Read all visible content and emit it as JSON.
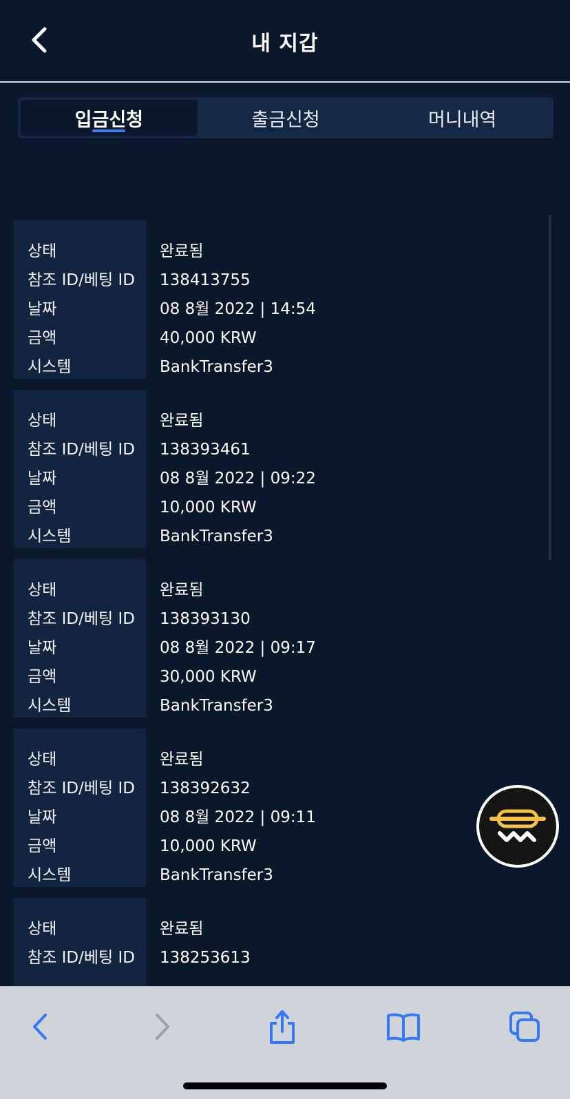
{
  "header": {
    "title": "내 지갑"
  },
  "tabs": [
    {
      "label": "입금신청",
      "active": true
    },
    {
      "label": "출금신청",
      "active": false
    },
    {
      "label": "머니내역",
      "active": false
    }
  ],
  "field_labels": {
    "status": "상태",
    "ref_id": "참조 ID/베팅 ID",
    "date": "날짜",
    "amount": "금액",
    "system": "시스템"
  },
  "transactions": [
    {
      "status": "완료됨",
      "ref_id": "138413755",
      "date": "08 8월 2022 | 14:54",
      "amount": "40,000 KRW",
      "system": "BankTransfer3"
    },
    {
      "status": "완료됨",
      "ref_id": "138393461",
      "date": "08 8월 2022 | 09:22",
      "amount": "10,000 KRW",
      "system": "BankTransfer3"
    },
    {
      "status": "완료됨",
      "ref_id": "138393130",
      "date": "08 8월 2022 | 09:17",
      "amount": "30,000 KRW",
      "system": "BankTransfer3"
    },
    {
      "status": "완료됨",
      "ref_id": "138392632",
      "date": "08 8월 2022 | 09:11",
      "amount": "10,000 KRW",
      "system": "BankTransfer3"
    },
    {
      "status": "완료됨",
      "ref_id": "138253613"
    }
  ],
  "icons": {
    "back": "chevron-left-icon",
    "support": "chat-support-icon",
    "browser_back": "chevron-left-icon",
    "browser_forward": "chevron-right-icon",
    "share": "share-icon",
    "bookmarks": "book-icon",
    "tabs": "tabs-icon"
  },
  "colors": {
    "background": "#0b172a",
    "card_label_bg": "#132440",
    "tab_bar_bg": "#142845",
    "accent": "#3d7ff0",
    "support_yellow": "#f5c243",
    "toolbar_bg": "#cfd3da",
    "toolbar_icon": "#3478f6"
  }
}
